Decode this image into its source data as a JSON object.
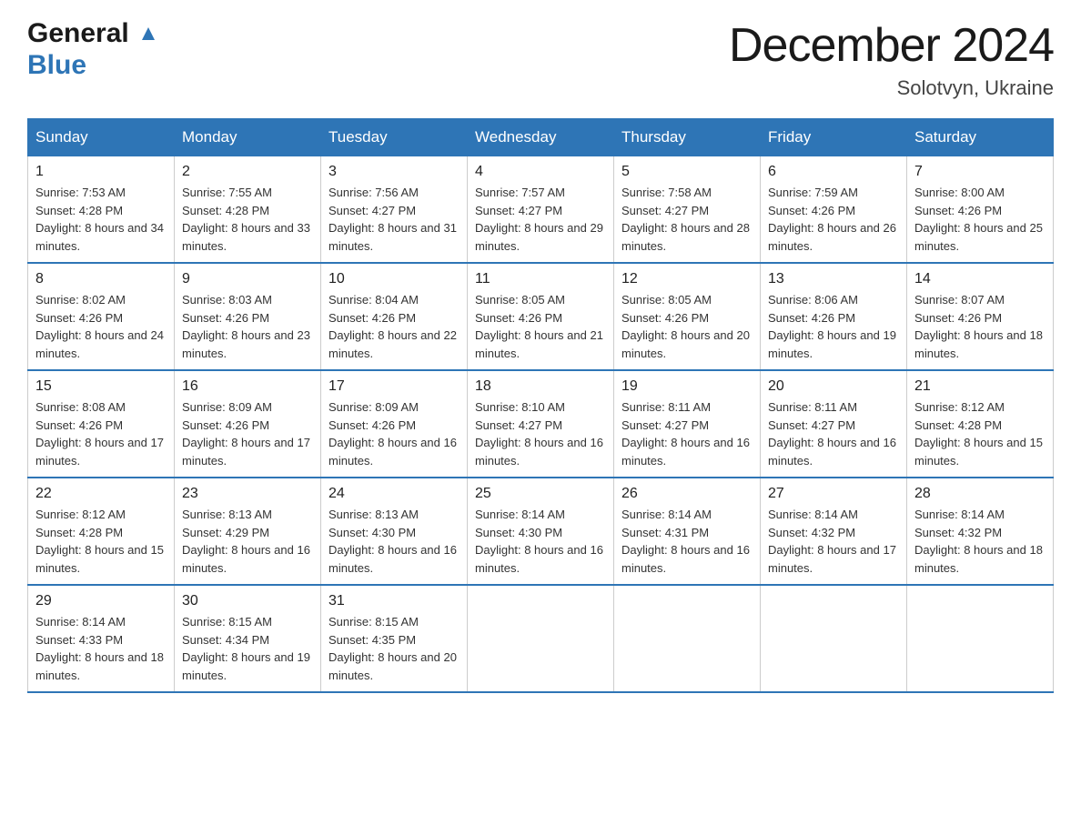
{
  "header": {
    "logo_general": "General",
    "logo_blue": "Blue",
    "month_title": "December 2024",
    "location": "Solotvyn, Ukraine"
  },
  "weekdays": [
    "Sunday",
    "Monday",
    "Tuesday",
    "Wednesday",
    "Thursday",
    "Friday",
    "Saturday"
  ],
  "weeks": [
    [
      {
        "day": "1",
        "sunrise": "7:53 AM",
        "sunset": "4:28 PM",
        "daylight": "8 hours and 34 minutes."
      },
      {
        "day": "2",
        "sunrise": "7:55 AM",
        "sunset": "4:28 PM",
        "daylight": "8 hours and 33 minutes."
      },
      {
        "day": "3",
        "sunrise": "7:56 AM",
        "sunset": "4:27 PM",
        "daylight": "8 hours and 31 minutes."
      },
      {
        "day": "4",
        "sunrise": "7:57 AM",
        "sunset": "4:27 PM",
        "daylight": "8 hours and 29 minutes."
      },
      {
        "day": "5",
        "sunrise": "7:58 AM",
        "sunset": "4:27 PM",
        "daylight": "8 hours and 28 minutes."
      },
      {
        "day": "6",
        "sunrise": "7:59 AM",
        "sunset": "4:26 PM",
        "daylight": "8 hours and 26 minutes."
      },
      {
        "day": "7",
        "sunrise": "8:00 AM",
        "sunset": "4:26 PM",
        "daylight": "8 hours and 25 minutes."
      }
    ],
    [
      {
        "day": "8",
        "sunrise": "8:02 AM",
        "sunset": "4:26 PM",
        "daylight": "8 hours and 24 minutes."
      },
      {
        "day": "9",
        "sunrise": "8:03 AM",
        "sunset": "4:26 PM",
        "daylight": "8 hours and 23 minutes."
      },
      {
        "day": "10",
        "sunrise": "8:04 AM",
        "sunset": "4:26 PM",
        "daylight": "8 hours and 22 minutes."
      },
      {
        "day": "11",
        "sunrise": "8:05 AM",
        "sunset": "4:26 PM",
        "daylight": "8 hours and 21 minutes."
      },
      {
        "day": "12",
        "sunrise": "8:05 AM",
        "sunset": "4:26 PM",
        "daylight": "8 hours and 20 minutes."
      },
      {
        "day": "13",
        "sunrise": "8:06 AM",
        "sunset": "4:26 PM",
        "daylight": "8 hours and 19 minutes."
      },
      {
        "day": "14",
        "sunrise": "8:07 AM",
        "sunset": "4:26 PM",
        "daylight": "8 hours and 18 minutes."
      }
    ],
    [
      {
        "day": "15",
        "sunrise": "8:08 AM",
        "sunset": "4:26 PM",
        "daylight": "8 hours and 17 minutes."
      },
      {
        "day": "16",
        "sunrise": "8:09 AM",
        "sunset": "4:26 PM",
        "daylight": "8 hours and 17 minutes."
      },
      {
        "day": "17",
        "sunrise": "8:09 AM",
        "sunset": "4:26 PM",
        "daylight": "8 hours and 16 minutes."
      },
      {
        "day": "18",
        "sunrise": "8:10 AM",
        "sunset": "4:27 PM",
        "daylight": "8 hours and 16 minutes."
      },
      {
        "day": "19",
        "sunrise": "8:11 AM",
        "sunset": "4:27 PM",
        "daylight": "8 hours and 16 minutes."
      },
      {
        "day": "20",
        "sunrise": "8:11 AM",
        "sunset": "4:27 PM",
        "daylight": "8 hours and 16 minutes."
      },
      {
        "day": "21",
        "sunrise": "8:12 AM",
        "sunset": "4:28 PM",
        "daylight": "8 hours and 15 minutes."
      }
    ],
    [
      {
        "day": "22",
        "sunrise": "8:12 AM",
        "sunset": "4:28 PM",
        "daylight": "8 hours and 15 minutes."
      },
      {
        "day": "23",
        "sunrise": "8:13 AM",
        "sunset": "4:29 PM",
        "daylight": "8 hours and 16 minutes."
      },
      {
        "day": "24",
        "sunrise": "8:13 AM",
        "sunset": "4:30 PM",
        "daylight": "8 hours and 16 minutes."
      },
      {
        "day": "25",
        "sunrise": "8:14 AM",
        "sunset": "4:30 PM",
        "daylight": "8 hours and 16 minutes."
      },
      {
        "day": "26",
        "sunrise": "8:14 AM",
        "sunset": "4:31 PM",
        "daylight": "8 hours and 16 minutes."
      },
      {
        "day": "27",
        "sunrise": "8:14 AM",
        "sunset": "4:32 PM",
        "daylight": "8 hours and 17 minutes."
      },
      {
        "day": "28",
        "sunrise": "8:14 AM",
        "sunset": "4:32 PM",
        "daylight": "8 hours and 18 minutes."
      }
    ],
    [
      {
        "day": "29",
        "sunrise": "8:14 AM",
        "sunset": "4:33 PM",
        "daylight": "8 hours and 18 minutes."
      },
      {
        "day": "30",
        "sunrise": "8:15 AM",
        "sunset": "4:34 PM",
        "daylight": "8 hours and 19 minutes."
      },
      {
        "day": "31",
        "sunrise": "8:15 AM",
        "sunset": "4:35 PM",
        "daylight": "8 hours and 20 minutes."
      },
      null,
      null,
      null,
      null
    ]
  ]
}
